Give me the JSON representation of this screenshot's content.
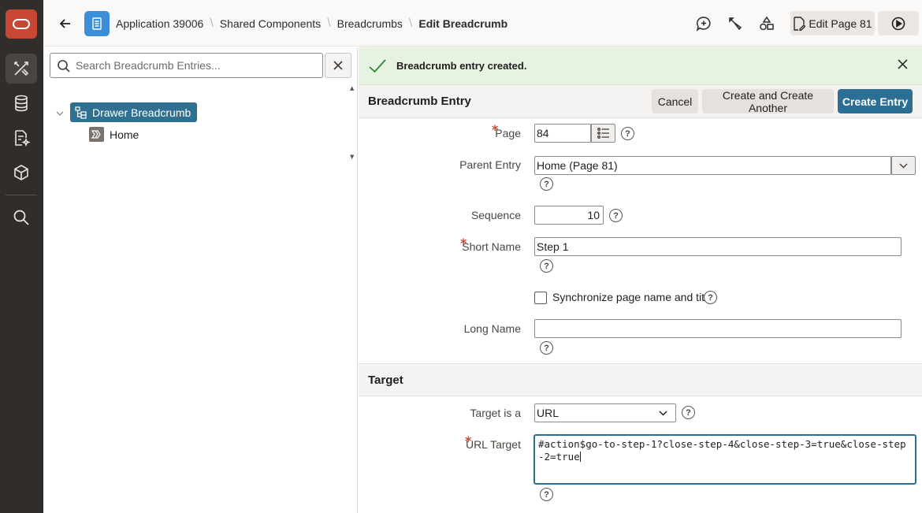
{
  "nav": {
    "items": [
      {
        "name": "app-builder-icon",
        "active": true
      },
      {
        "name": "sql-workshop-icon"
      },
      {
        "name": "team-development-icon"
      },
      {
        "name": "gallery-icon"
      },
      {
        "name": "search-icon"
      }
    ]
  },
  "header": {
    "breadcrumbs": [
      "Application 39006",
      "Shared Components",
      "Breadcrumbs"
    ],
    "current": "Edit Breadcrumb",
    "edit_page_label": "Edit Page 81"
  },
  "tree": {
    "search_placeholder": "Search Breadcrumb Entries...",
    "root_label": "Drawer Breadcrumb",
    "child_label": "Home"
  },
  "alert": {
    "message": "Breadcrumb entry created."
  },
  "entry_region": {
    "title": "Breadcrumb Entry",
    "buttons": {
      "cancel": "Cancel",
      "create_another": "Create and Create Another",
      "create": "Create Entry"
    },
    "fields": {
      "page": {
        "label": "Page",
        "value": "84"
      },
      "parent_entry": {
        "label": "Parent Entry",
        "value": "Home (Page 81)"
      },
      "sequence": {
        "label": "Sequence",
        "value": "10"
      },
      "short_name": {
        "label": "Short Name",
        "value": "Step 1"
      },
      "sync": {
        "label": "Synchronize page name and title"
      },
      "long_name": {
        "label": "Long Name",
        "value": ""
      }
    }
  },
  "target_region": {
    "title": "Target",
    "fields": {
      "target_is_a": {
        "label": "Target is a",
        "value": "URL"
      },
      "url_target": {
        "label": "URL Target",
        "value": "#action$go-to-step-1?close-step-4&close-step-3=true&close-step-2=true"
      }
    }
  },
  "help_glyph": "?",
  "colors": {
    "nav_bg": "#312d2a",
    "logo_red": "#c74634",
    "primary": "#2b6f95",
    "success_bg": "#e6f3e0",
    "success_check": "#2e8540"
  }
}
